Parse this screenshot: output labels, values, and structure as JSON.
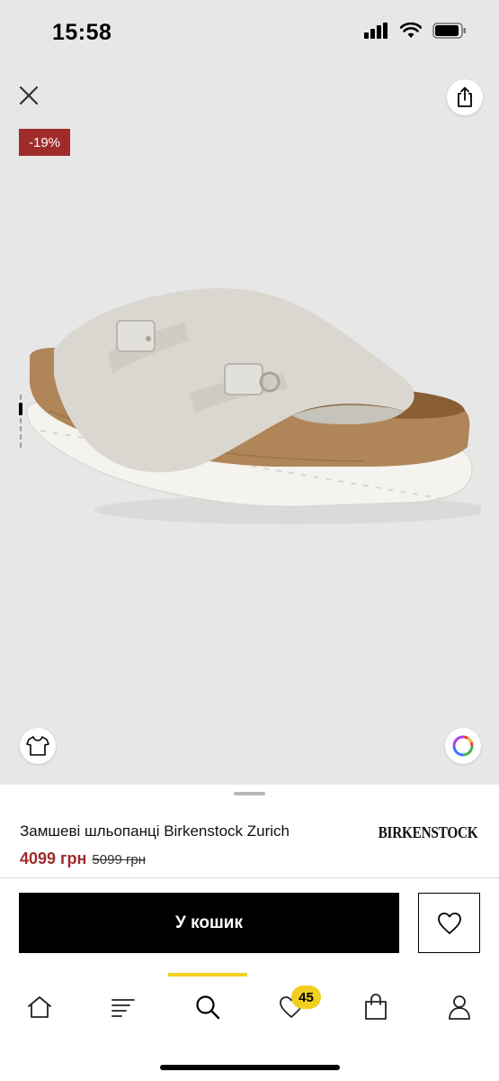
{
  "status_bar": {
    "time": "15:58"
  },
  "gallery": {
    "discount_badge": "-19%",
    "image_count": 4,
    "active_image_index": 0,
    "background_color": "#e7e7e7"
  },
  "product": {
    "title": "Замшеві шльопанці Birkenstock Zurich",
    "brand": "BIRKENSTOCK",
    "price_current": "4099 грн",
    "price_old": "5099 грн",
    "price_color": "#a02b2b"
  },
  "actions": {
    "cart_label": "У кошик"
  },
  "tab_bar": {
    "accent_color": "#f2cf1f",
    "active_tab": "search",
    "items": [
      {
        "id": "home",
        "icon": "home-icon"
      },
      {
        "id": "catalog",
        "icon": "menu-icon"
      },
      {
        "id": "search",
        "icon": "search-icon"
      },
      {
        "id": "favorites",
        "icon": "heart-icon",
        "badge": "45"
      },
      {
        "id": "bag",
        "icon": "bag-icon"
      },
      {
        "id": "profile",
        "icon": "profile-icon"
      }
    ]
  }
}
